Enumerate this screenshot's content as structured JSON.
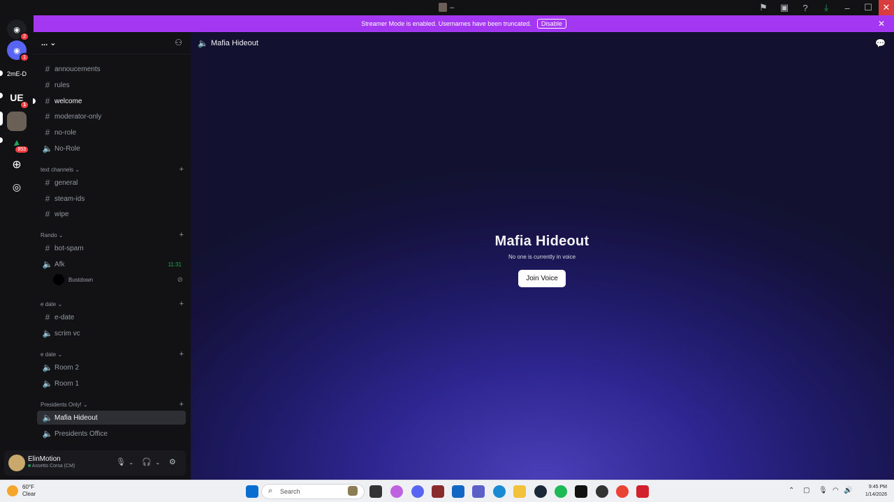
{
  "titlebar": {
    "center_text": "–"
  },
  "servers": {
    "home_badge": "2",
    "server1_badge": "1",
    "server2_label": "2mE-D",
    "server3_label": "UE",
    "server3_badge": "1",
    "server5_badge": "853"
  },
  "banner": {
    "message": "Streamer Mode is enabled. Usernames have been truncated.",
    "disable_label": "Disable"
  },
  "sidebar": {
    "server_name": "...",
    "channels_top": [
      {
        "label": "annoucements"
      },
      {
        "label": "rules"
      },
      {
        "label": "welcome"
      },
      {
        "label": "moderator-only"
      },
      {
        "label": "no-role"
      },
      {
        "label": "No-Role"
      }
    ],
    "categories": {
      "text": "text channels",
      "rando": "Rando",
      "edate1": "e date",
      "edate2": "e date",
      "presidents": "Presidents Only!"
    },
    "text_channels": [
      {
        "label": "general"
      },
      {
        "label": "steam-ids"
      },
      {
        "label": "wipe"
      }
    ],
    "rando_channels": [
      {
        "label": "bot-spam"
      },
      {
        "label": "Afk",
        "timer": "11:31"
      }
    ],
    "voice_user": "Bustdown",
    "edate1_channels": [
      {
        "label": "e-date"
      },
      {
        "label": "scrim vc"
      }
    ],
    "edate2_channels": [
      {
        "label": "Room 2"
      },
      {
        "label": "Room 1"
      }
    ],
    "presidents_channels": [
      {
        "label": "Mafia Hideout"
      },
      {
        "label": "Presidents Office"
      }
    ]
  },
  "user": {
    "name": "ElinMotion",
    "status": "Assetto Corsa (CM)"
  },
  "main": {
    "channel_name": "Mafia Hideout",
    "title": "Mafia Hideout",
    "subtitle": "No one is currently in voice",
    "join_label": "Join Voice"
  },
  "taskbar": {
    "temp": "60°F",
    "condition": "Clear",
    "search_placeholder": "Search",
    "time": "9:45 PM",
    "date": "1/14/2026"
  },
  "colors": {
    "banner": "#a337f2",
    "accent_green": "#23a55a",
    "badge_red": "#f23f43"
  }
}
